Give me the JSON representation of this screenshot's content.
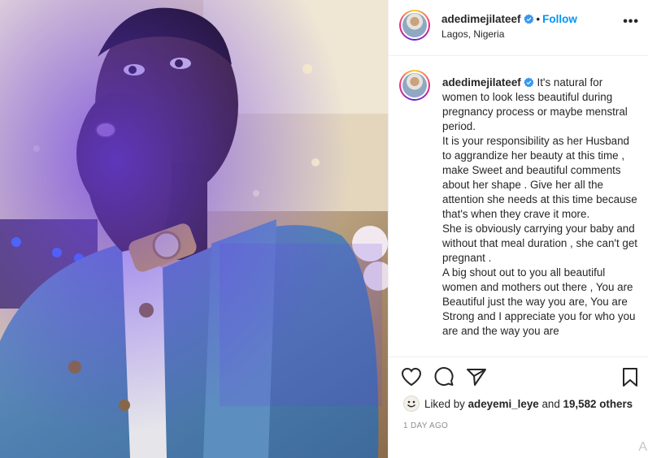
{
  "post": {
    "username": "adedimejilateef",
    "location": "Lagos, Nigeria",
    "follow_label": "Follow",
    "separator": "•",
    "more_label": "•••",
    "caption": {
      "username": "adedimejilateef",
      "paragraphs": [
        "It's natural for women to look less beautiful during pregnancy process or maybe menstral period.",
        "It is your responsibility as her Husband to aggrandize her beauty at this time , make Sweet and beautiful comments about her shape . Give her all the attention she needs at this time because that's when they crave it more.",
        "She is obviously carrying your baby and without that meal duration , she can't get pregnant .",
        "A big shout out to you all beautiful women and mothers out there , You are Beautiful just the way you are, You are Strong and I appreciate you for who you are and the way you are"
      ]
    },
    "likes": {
      "prefix": "Liked by",
      "user": "adeyemi_leye",
      "conjunction": "and",
      "others": "19,582 others"
    },
    "timestamp": "1 DAY AGO",
    "corner_letter": "A"
  },
  "icons": {
    "verified": "verified-badge-icon",
    "like": "heart-icon",
    "comment": "comment-bubble-icon",
    "share": "paper-plane-icon",
    "save": "bookmark-icon",
    "more": "more-options-icon"
  },
  "colors": {
    "verified_blue": "#3897f0",
    "follow_blue": "#0095f6",
    "text": "#262626",
    "muted": "#8e8e8e",
    "border": "#efefef"
  }
}
